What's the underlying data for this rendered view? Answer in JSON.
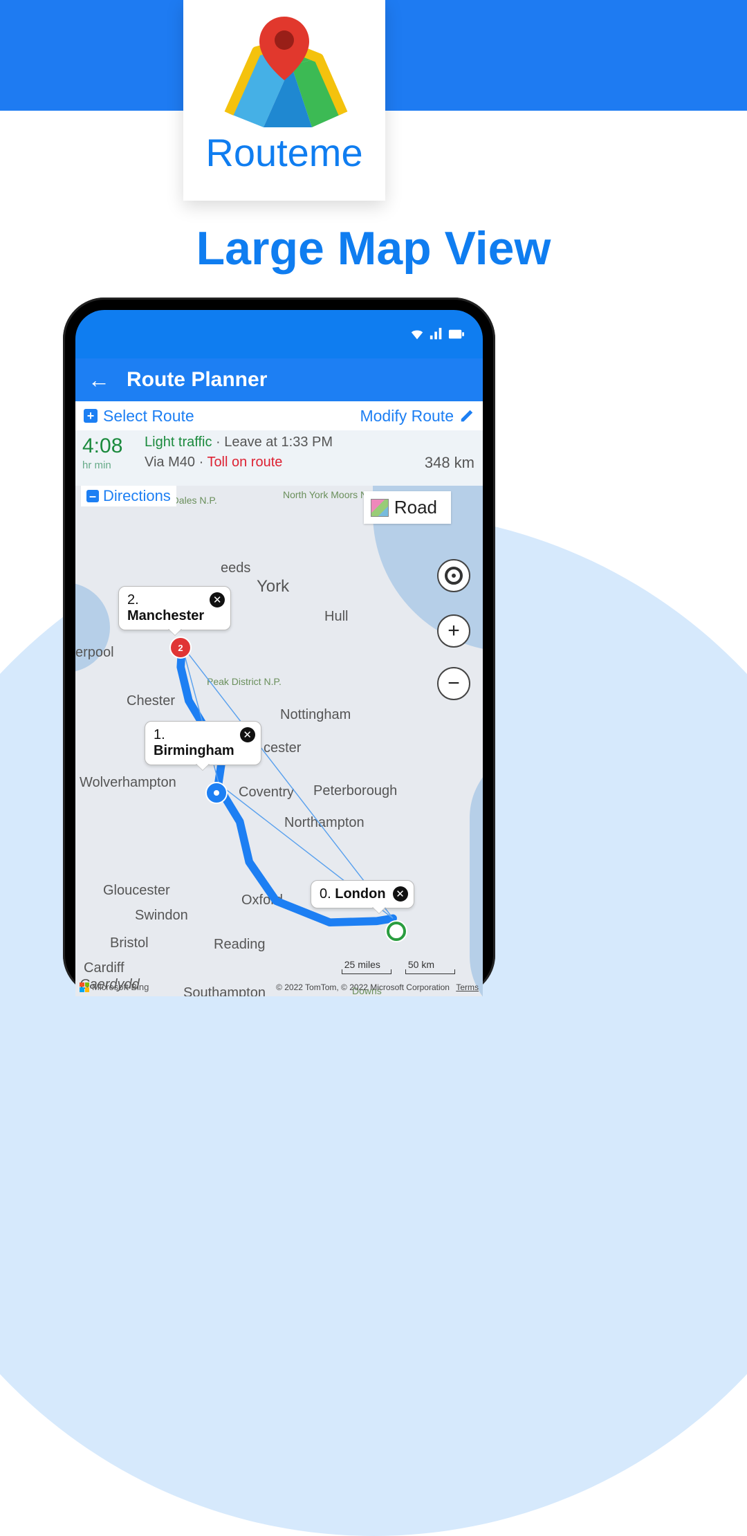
{
  "promo": {
    "brand": "Routeme",
    "headline": "Large Map View"
  },
  "statusbar": {
    "wifi_icon": "wifi-icon",
    "signal_icon": "cell-signal-icon",
    "battery_icon": "battery-icon"
  },
  "appbar": {
    "back_icon": "←",
    "title": "Route Planner"
  },
  "subbar": {
    "select_label": "Select Route",
    "modify_label": "Modify Route"
  },
  "summary": {
    "time_value": "4:08",
    "time_units": "hr   min",
    "traffic": "Light traffic",
    "sep": " · ",
    "leave": "Leave at 1:33 PM",
    "via": "Via M40",
    "sep2": " · ",
    "toll": "Toll on route",
    "distance": "348 km"
  },
  "directions_label": "Directions",
  "map": {
    "type_label": "Road",
    "np_labels": {
      "york_dales": "orkshire\nDales N.P.",
      "ny_moors": "North\nYork\nMoors\nN.P.",
      "peak": "Peak\nDistrict\nN.P."
    },
    "cities": {
      "york": "York",
      "leeds": "eeds",
      "hull": "Hull",
      "liverpool": "erpool",
      "chester": "Chester",
      "nottingham": "Nottingham",
      "leicester": "cester",
      "coventry": "Coventry",
      "peterborough": "Peterborough",
      "northampton": "Northampton",
      "wolverhampton": "Wolverhampton",
      "gloucester": "Gloucester",
      "oxford": "Oxford",
      "swindon": "Swindon",
      "bristol": "Bristol",
      "reading": "Reading",
      "cardiff": "Cardiff",
      "caerdydd": "Caerdydd",
      "southampton": "Southampton",
      "downs": "Downs"
    },
    "waypoints": [
      {
        "idx": "0.",
        "name": "London"
      },
      {
        "idx": "1.",
        "name": "Birmingham"
      },
      {
        "idx": "2.",
        "name": "Manchester"
      }
    ],
    "controls": {
      "locate": "locate",
      "zoom_in": "+",
      "zoom_out": "−"
    },
    "scale": {
      "left": "25 miles",
      "right": "50 km"
    },
    "attribution_brand": "Microsoft Bing",
    "copyright": "© 2022 TomTom, © 2022 Microsoft Corporation",
    "terms": "Terms"
  }
}
